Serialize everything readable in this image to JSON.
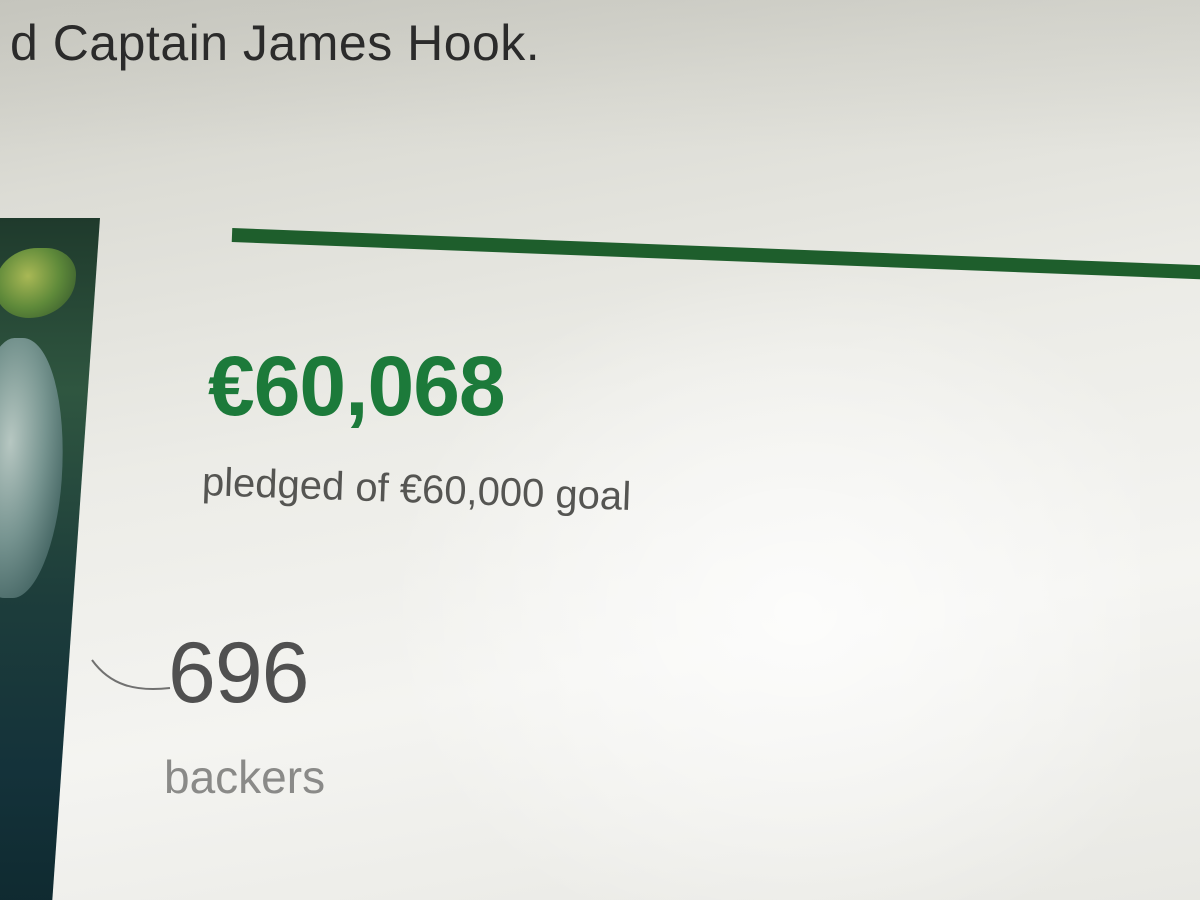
{
  "header": {
    "text": "d Captain James Hook."
  },
  "funding": {
    "pledged_amount": "€60,068",
    "pledged_label": "pledged of €60,000 goal",
    "progress": 1.0,
    "accent_color": "#1c7a3a",
    "bar_color": "#1e5e2c"
  },
  "backers": {
    "count": "696",
    "label": "backers"
  },
  "thumbnail": {
    "icon": "project-image"
  }
}
